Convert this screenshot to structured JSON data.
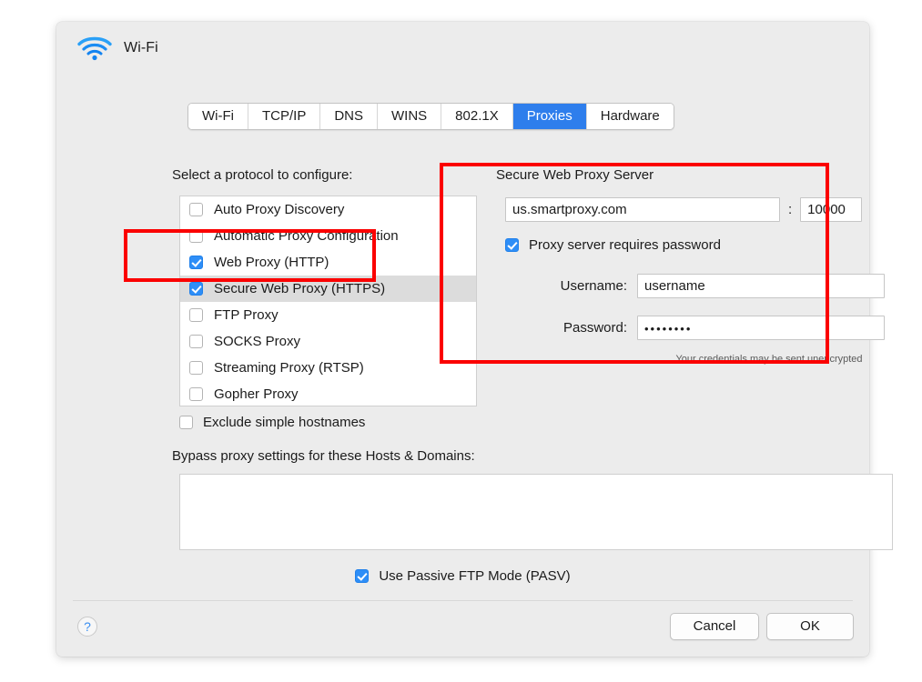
{
  "window": {
    "title": "Wi-Fi",
    "icon": "wifi-icon",
    "accent_color": "#2e7eec",
    "annotation_color": "#fb0000"
  },
  "tabs": [
    {
      "label": "Wi-Fi",
      "active": false
    },
    {
      "label": "TCP/IP",
      "active": false
    },
    {
      "label": "DNS",
      "active": false
    },
    {
      "label": "WINS",
      "active": false
    },
    {
      "label": "802.1X",
      "active": false
    },
    {
      "label": "Proxies",
      "active": true
    },
    {
      "label": "Hardware",
      "active": false
    }
  ],
  "protocols": {
    "label": "Select a protocol to configure:",
    "items": [
      {
        "label": "Auto Proxy Discovery",
        "checked": false,
        "selected": false
      },
      {
        "label": "Automatic Proxy Configuration",
        "checked": false,
        "selected": false
      },
      {
        "label": "Web Proxy (HTTP)",
        "checked": true,
        "selected": false
      },
      {
        "label": "Secure Web Proxy (HTTPS)",
        "checked": true,
        "selected": true
      },
      {
        "label": "FTP Proxy",
        "checked": false,
        "selected": false
      },
      {
        "label": "SOCKS Proxy",
        "checked": false,
        "selected": false
      },
      {
        "label": "Streaming Proxy (RTSP)",
        "checked": false,
        "selected": false
      },
      {
        "label": "Gopher Proxy",
        "checked": false,
        "selected": false
      }
    ]
  },
  "exclude_simple_hostnames": {
    "label": "Exclude simple hostnames",
    "checked": false
  },
  "bypass": {
    "label": "Bypass proxy settings for these Hosts & Domains:",
    "value": ""
  },
  "passive_ftp": {
    "label": "Use Passive FTP Mode (PASV)",
    "checked": true
  },
  "server": {
    "title": "Secure Web Proxy Server",
    "host": "us.smartproxy.com",
    "host_placeholder": "",
    "separator": ":",
    "port": "10000",
    "requires_password": {
      "label": "Proxy server requires password",
      "checked": true
    },
    "username_label": "Username:",
    "username": "username",
    "username_placeholder": "",
    "password_label": "Password:",
    "password": "••••••••",
    "password_placeholder": "",
    "note": "Your credentials may be sent unencrypted"
  },
  "footer": {
    "help": "?",
    "cancel_label": "Cancel",
    "ok_label": "OK"
  }
}
